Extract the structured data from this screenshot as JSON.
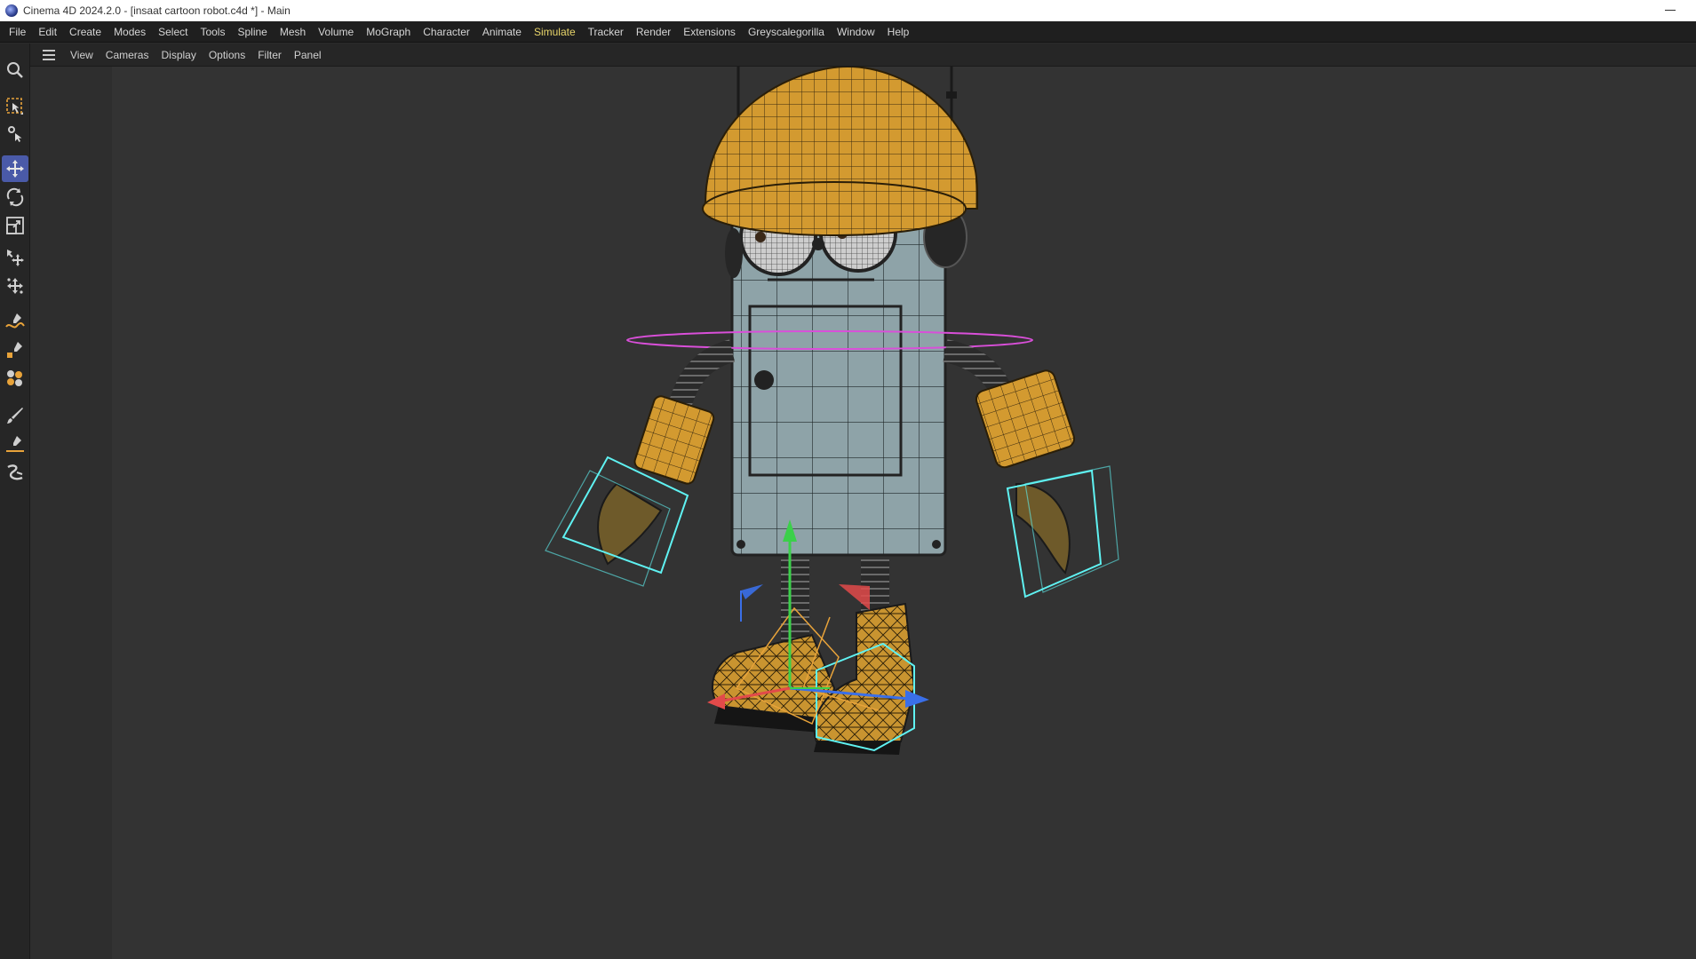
{
  "window": {
    "title": "Cinema 4D 2024.2.0 - [insaat cartoon robot.c4d *] - Main"
  },
  "menubar": {
    "items": [
      "File",
      "Edit",
      "Create",
      "Modes",
      "Select",
      "Tools",
      "Spline",
      "Mesh",
      "Volume",
      "MoGraph",
      "Character",
      "Animate",
      "Simulate",
      "Tracker",
      "Render",
      "Extensions",
      "Greyscalegorilla",
      "Window",
      "Help"
    ],
    "active": "Simulate"
  },
  "viewbar": {
    "items": [
      "View",
      "Cameras",
      "Display",
      "Options",
      "Filter",
      "Panel"
    ]
  },
  "toolbar": {
    "tools": [
      {
        "icon": "search-icon",
        "active": false
      },
      {
        "icon": "select-icon",
        "active": false
      },
      {
        "icon": "selection-filter-icon",
        "active": false
      },
      {
        "icon": "move-icon",
        "active": true
      },
      {
        "icon": "rotate-icon",
        "active": false
      },
      {
        "icon": "scale-icon",
        "active": false
      },
      {
        "icon": "transfer-icon",
        "active": false
      },
      {
        "icon": "multi-move-icon",
        "active": false
      },
      {
        "icon": "spline-pen-icon",
        "active": false
      },
      {
        "icon": "spline-point-icon",
        "active": false
      },
      {
        "icon": "volume-brush-icon",
        "active": false
      },
      {
        "icon": "brush-icon",
        "active": false
      },
      {
        "icon": "pen-line-icon",
        "active": false
      },
      {
        "icon": "spline-smooth-icon",
        "active": false
      }
    ]
  },
  "colors": {
    "accent": "#4a5aa8",
    "active_menu": "#e8d56a",
    "helmet": "#d9a237",
    "selection_box": "#5ff2f2",
    "ring": "#d94fd9"
  }
}
